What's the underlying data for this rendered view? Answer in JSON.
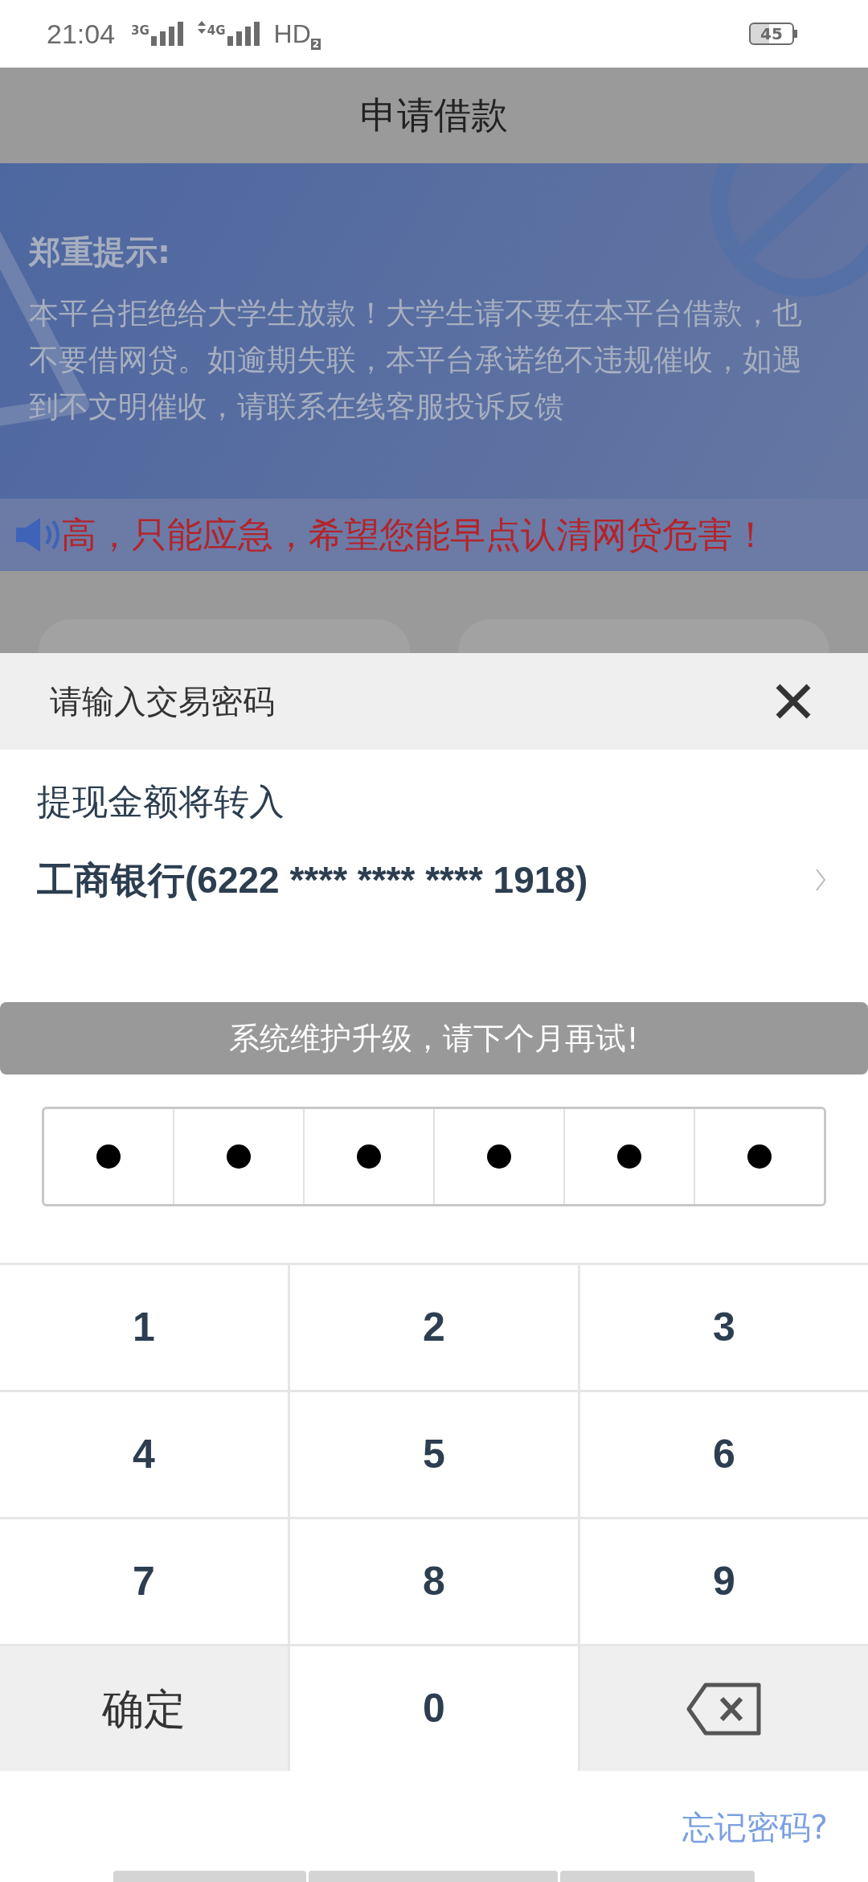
{
  "status_bar": {
    "time": "21:04",
    "network_1": "3G",
    "network_2": "4G",
    "hd": "HD",
    "hd_sub": "2",
    "battery": "45"
  },
  "header": {
    "title": "申请借款"
  },
  "notice": {
    "title": "郑重提示:",
    "body": "本平台拒绝给大学生放款！大学生请不要在本平台借款，也不要借网贷。如逾期失联，本平台承诺绝不违规催收，如遇到不文明催收，请联系在线客服投诉反馈"
  },
  "marquee": {
    "text": "高，只能应急，希望您能早点认清网贷危害！"
  },
  "dialog": {
    "title": "请输入交易密码",
    "transfer_label": "提现金额将转入",
    "bank_account": "工商银行(6222 **** **** **** 1918)",
    "message": "系统维护升级，请下个月再试!",
    "pin": [
      {
        "filled": true
      },
      {
        "filled": true
      },
      {
        "filled": true
      },
      {
        "filled": true
      },
      {
        "filled": true
      },
      {
        "filled": true
      }
    ],
    "keys": [
      {
        "kind": "digit",
        "label": "1"
      },
      {
        "kind": "digit",
        "label": "2"
      },
      {
        "kind": "digit",
        "label": "3"
      },
      {
        "kind": "digit",
        "label": "4"
      },
      {
        "kind": "digit",
        "label": "5"
      },
      {
        "kind": "digit",
        "label": "6"
      },
      {
        "kind": "digit",
        "label": "7"
      },
      {
        "kind": "digit",
        "label": "8"
      },
      {
        "kind": "digit",
        "label": "9"
      },
      {
        "kind": "confirm",
        "label": "确定"
      },
      {
        "kind": "digit",
        "label": "0"
      },
      {
        "kind": "backspace"
      }
    ],
    "forgot_link": "忘记密码?"
  }
}
